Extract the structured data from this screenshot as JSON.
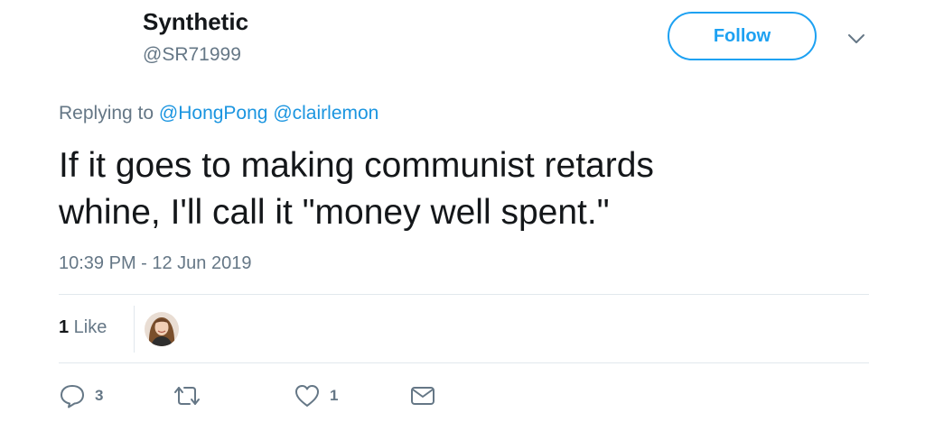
{
  "user": {
    "display_name": "Synthetic",
    "handle": "@SR71999"
  },
  "follow_button": {
    "label": "Follow"
  },
  "reply_context": {
    "prefix": "Replying to ",
    "mentions": [
      "@HongPong",
      "@clairlemon"
    ]
  },
  "tweet": {
    "text_line1": "If it goes to making communist retards",
    "text_line2": "whine, I'll call it \"money well spent.\"",
    "timestamp": "10:39 PM - 12 Jun 2019"
  },
  "stats": {
    "likes_number": "1",
    "likes_label": " Like"
  },
  "actions": {
    "reply_count": "3",
    "retweet_count": "",
    "like_count": "1"
  },
  "icons": {
    "menu": "chevron-down-icon",
    "reply": "reply-icon",
    "retweet": "retweet-icon",
    "like": "heart-icon",
    "message": "envelope-icon"
  },
  "colors": {
    "accent": "#1da1f2",
    "mention": "#1b95e0",
    "secondary_text": "#657786",
    "divider": "#e1e8ed"
  }
}
